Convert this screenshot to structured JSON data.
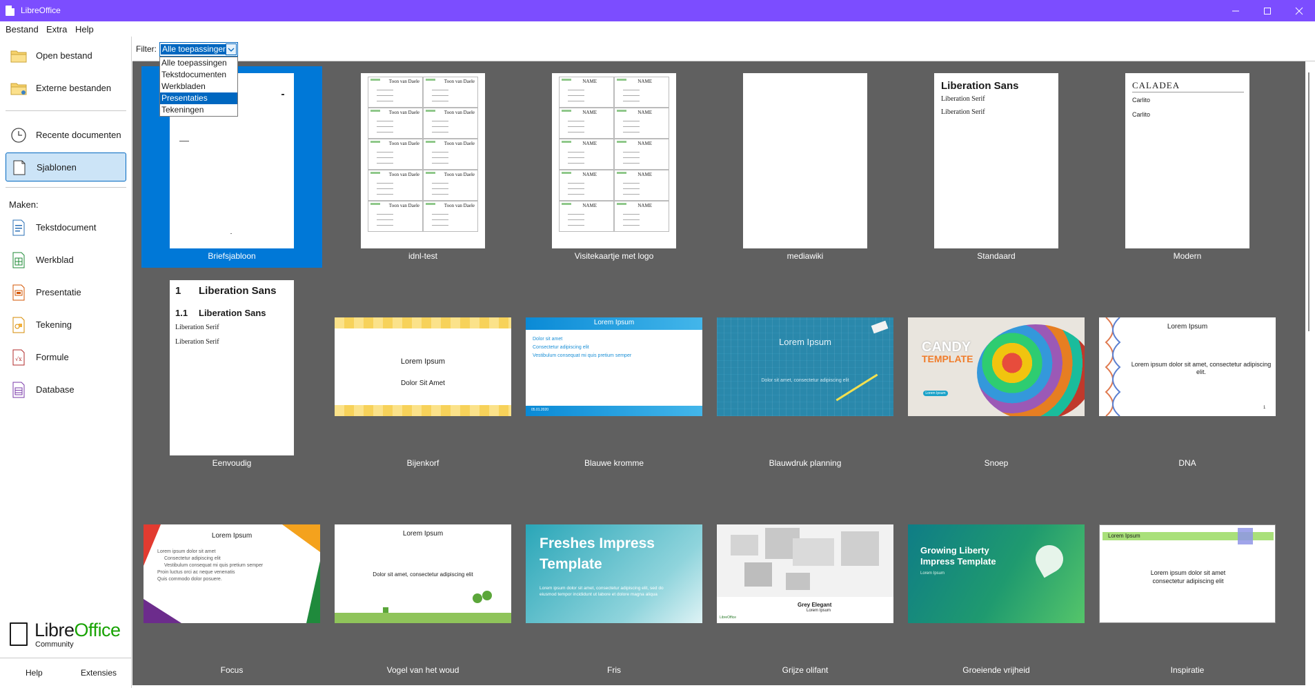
{
  "window": {
    "title": "LibreOffice"
  },
  "menu": {
    "items": [
      "Bestand",
      "Extra",
      "Help"
    ]
  },
  "sidebar": {
    "open_file": "Open bestand",
    "remote_files": "Externe bestanden",
    "recent_docs": "Recente documenten",
    "templates": "Sjablonen",
    "create_heading": "Maken:",
    "create_items": [
      "Tekstdocument",
      "Werkblad",
      "Presentatie",
      "Tekening",
      "Formule",
      "Database"
    ],
    "logo": {
      "libre": "Libre",
      "office": "Office",
      "community": "Community"
    },
    "help": "Help",
    "extensions": "Extensies"
  },
  "filter": {
    "label": "Filter:",
    "selected": "Alle toepassingen",
    "options": [
      "Alle toepassingen",
      "Tekstdocumenten",
      "Werkbladen",
      "Presentaties",
      "Tekeningen"
    ],
    "highlighted": "Presentaties"
  },
  "templates": [
    {
      "name": "Briefsjabloon",
      "selected": true
    },
    {
      "name": "idnl-test"
    },
    {
      "name": "Visitekaartje met logo"
    },
    {
      "name": "mediawiki"
    },
    {
      "name": "Standaard"
    },
    {
      "name": "Modern"
    },
    {
      "name": "Eenvoudig"
    },
    {
      "name": "Bijenkorf"
    },
    {
      "name": "Blauwe kromme"
    },
    {
      "name": "Blauwdruk planning"
    },
    {
      "name": "Snoep"
    },
    {
      "name": "DNA"
    },
    {
      "name": "Focus"
    },
    {
      "name": "Vogel van het woud"
    },
    {
      "name": "Fris"
    },
    {
      "name": "Grijze olifant"
    },
    {
      "name": "Groeiende vrijheid"
    },
    {
      "name": "Inspiratie"
    }
  ],
  "thumbs": {
    "idnl": {
      "name_text": "Toon van Daele"
    },
    "visit": {
      "name_text": "NAME"
    },
    "standaard": {
      "heading": "Liberation Sans",
      "line1": "Liberation Serif",
      "line2": "Liberation Serif"
    },
    "modern": {
      "heading": "CALADEA",
      "line1": "Carlito",
      "line2": "Carlito"
    },
    "eenvoudig": {
      "h1_num": "1",
      "h1": "Liberation Sans",
      "h2_num": "1.1",
      "h2": "Liberation Sans",
      "line1": "Liberation Serif",
      "line2": "Liberation Serif"
    },
    "bijenkorf": {
      "title": "Lorem Ipsum",
      "subtitle": "Dolor Sit Amet"
    },
    "blauwe": {
      "title": "Lorem Ipsum",
      "bullets": [
        "Dolor sit amet",
        "Consectetur adipiscing elit",
        "Vestibulum consequat mi quis pretium semper"
      ],
      "footer_date": "05.01.2020"
    },
    "blauwdruk": {
      "title": "Lorem Ipsum",
      "subtitle": "Dolor sit amet, consectetur adipiscing elit"
    },
    "snoep": {
      "title1": "CANDY",
      "title2": "TEMPLATE",
      "sub": "Lorem Ipsum"
    },
    "dna": {
      "title": "Lorem Ipsum",
      "body": "Lorem ipsum dolor sit amet, consectetur adipiscing elit.",
      "page": "1"
    },
    "focus": {
      "title": "Lorem Ipsum",
      "bullets": [
        "Lorem ipsum dolor sit amet",
        "Consectetur adipiscing elit",
        "Vestibulum consequat mi quis pretium semper",
        "Proin luctus orci ac neque venenatis",
        "Quis commodo dolor posuere."
      ]
    },
    "vogel": {
      "title": "Lorem Ipsum",
      "body": "Dolor sit amet, consectetur adipiscing elit"
    },
    "fris": {
      "title1": "Freshes Impress",
      "title2": "Template",
      "body": "Lorem ipsum dolor sit amet, consectetur adipiscing elit, sed do eiusmod tempor incididunt ut labore et dolore magna aliqua"
    },
    "grijze": {
      "title": "Grey Elegant",
      "sub": "Lorem Ipsum",
      "logo": "LibreOffice"
    },
    "groeiende": {
      "title1": "Growing Liberty",
      "title2": "Impress Template",
      "sub": "Lorem Ipsum"
    },
    "inspiratie": {
      "title": "Lorem Ipsum",
      "body1": "Lorem ipsum dolor sit amet",
      "body2": "consectetur adipiscing elit"
    }
  }
}
